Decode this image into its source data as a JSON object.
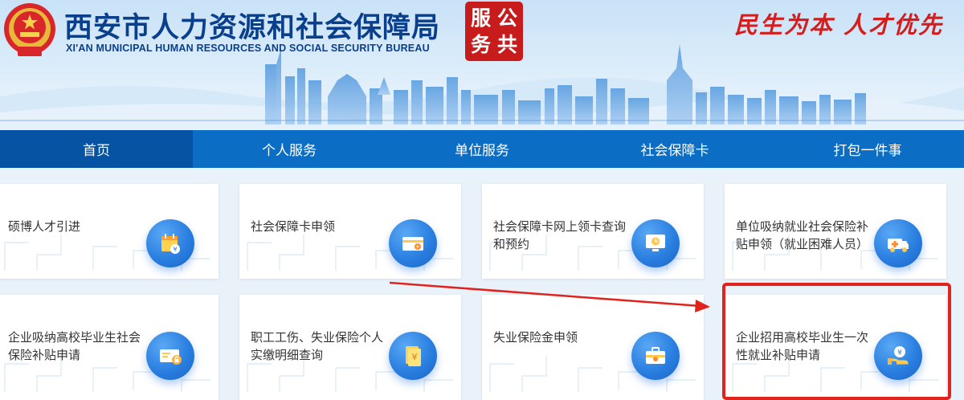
{
  "header": {
    "title_cn": "西安市人力资源和社会保障局",
    "title_en": "XI'AN MUNICIPAL HUMAN RESOURCES AND SOCIAL SECURITY BUREAU",
    "seal_chars": [
      "服",
      "公",
      "务",
      "共"
    ],
    "slogan": "民生为本 人才优先"
  },
  "nav": {
    "items": [
      {
        "label": "首页",
        "active": true
      },
      {
        "label": "个人服务",
        "active": false
      },
      {
        "label": "单位服务",
        "active": false
      },
      {
        "label": "社会保障卡",
        "active": false
      },
      {
        "label": "打包一件事",
        "active": false
      }
    ]
  },
  "services": [
    {
      "label": "硕博人才引进",
      "icon": "calendar-yuan-icon"
    },
    {
      "label": "社会保障卡申领",
      "icon": "card-lightning-icon"
    },
    {
      "label": "社会保障卡网上领卡查询和预约",
      "icon": "monitor-clock-icon"
    },
    {
      "label": "单位吸纳就业社会保险补贴申领（就业困难人员）",
      "icon": "ambulance-icon"
    },
    {
      "label": "企业吸纳高校毕业生社会保险补贴申请",
      "icon": "card-lock-icon"
    },
    {
      "label": "职工工伤、失业保险个人实缴明细查询",
      "icon": "document-yuan-icon"
    },
    {
      "label": "失业保险金申领",
      "icon": "briefcase-icon"
    },
    {
      "label": "企业招用高校毕业生一次性就业补贴申请",
      "icon": "hand-coin-icon"
    }
  ],
  "colors": {
    "nav_bg": "#0b6dc3",
    "nav_active": "#0652a3",
    "brand_text": "#0a3f8c",
    "seal_red": "#c81b1b",
    "annotation_red": "#e0231c"
  }
}
